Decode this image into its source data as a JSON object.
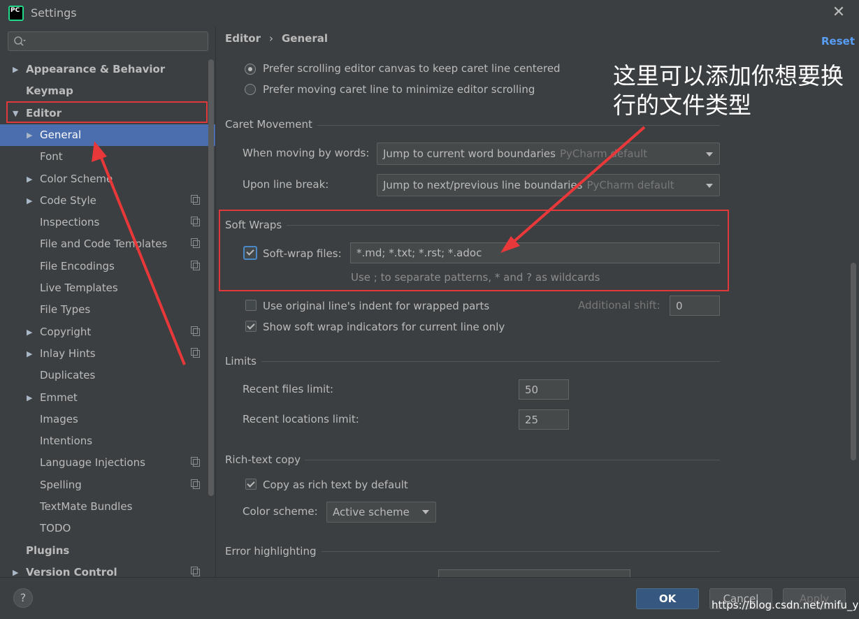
{
  "window": {
    "title": "Settings",
    "logo_text": "PC"
  },
  "search": {
    "placeholder": ""
  },
  "tree": [
    {
      "label": "Appearance & Behavior",
      "bold": true,
      "arrow": true,
      "indent": 0,
      "copy": false
    },
    {
      "label": "Keymap",
      "bold": true,
      "arrow": false,
      "indent": 0,
      "copy": false
    },
    {
      "label": "Editor",
      "bold": true,
      "arrow": true,
      "expanded": true,
      "indent": 0,
      "copy": false
    },
    {
      "label": "General",
      "bold": false,
      "arrow": true,
      "indent": 1,
      "selected": true,
      "copy": false
    },
    {
      "label": "Font",
      "bold": false,
      "arrow": false,
      "indent": 1,
      "copy": false
    },
    {
      "label": "Color Scheme",
      "bold": false,
      "arrow": true,
      "indent": 1,
      "copy": false
    },
    {
      "label": "Code Style",
      "bold": false,
      "arrow": true,
      "indent": 1,
      "copy": true
    },
    {
      "label": "Inspections",
      "bold": false,
      "arrow": false,
      "indent": 1,
      "copy": true
    },
    {
      "label": "File and Code Templates",
      "bold": false,
      "arrow": false,
      "indent": 1,
      "copy": true
    },
    {
      "label": "File Encodings",
      "bold": false,
      "arrow": false,
      "indent": 1,
      "copy": true
    },
    {
      "label": "Live Templates",
      "bold": false,
      "arrow": false,
      "indent": 1,
      "copy": false
    },
    {
      "label": "File Types",
      "bold": false,
      "arrow": false,
      "indent": 1,
      "copy": false
    },
    {
      "label": "Copyright",
      "bold": false,
      "arrow": true,
      "indent": 1,
      "copy": true
    },
    {
      "label": "Inlay Hints",
      "bold": false,
      "arrow": true,
      "indent": 1,
      "copy": true
    },
    {
      "label": "Duplicates",
      "bold": false,
      "arrow": false,
      "indent": 1,
      "copy": false
    },
    {
      "label": "Emmet",
      "bold": false,
      "arrow": true,
      "indent": 1,
      "copy": false
    },
    {
      "label": "Images",
      "bold": false,
      "arrow": false,
      "indent": 1,
      "copy": false
    },
    {
      "label": "Intentions",
      "bold": false,
      "arrow": false,
      "indent": 1,
      "copy": false
    },
    {
      "label": "Language Injections",
      "bold": false,
      "arrow": false,
      "indent": 1,
      "copy": true
    },
    {
      "label": "Spelling",
      "bold": false,
      "arrow": false,
      "indent": 1,
      "copy": true
    },
    {
      "label": "TextMate Bundles",
      "bold": false,
      "arrow": false,
      "indent": 1,
      "copy": false
    },
    {
      "label": "TODO",
      "bold": false,
      "arrow": false,
      "indent": 1,
      "copy": false
    },
    {
      "label": "Plugins",
      "bold": true,
      "arrow": false,
      "indent": 0,
      "copy": false
    },
    {
      "label": "Version Control",
      "bold": true,
      "arrow": true,
      "indent": 0,
      "copy": true
    }
  ],
  "breadcrumb": {
    "root": "Editor",
    "sep": "›",
    "current": "General"
  },
  "reset_label": "Reset",
  "scrolling": {
    "option1": "Prefer scrolling editor canvas to keep caret line centered",
    "option2": "Prefer moving caret line to minimize editor scrolling"
  },
  "caret": {
    "title": "Caret Movement",
    "words_label": "When moving by words:",
    "words_value": "Jump to current word boundaries",
    "words_hint": "PyCharm default",
    "break_label": "Upon line break:",
    "break_value": "Jump to next/previous line boundaries",
    "break_hint": "PyCharm default"
  },
  "softwraps": {
    "title": "Soft Wraps",
    "files_label": "Soft-wrap files:",
    "files_value": "*.md; *.txt; *.rst; *.adoc",
    "help": "Use ; to separate patterns, * and ? as wildcards",
    "indent_label": "Use original line's indent for wrapped parts",
    "shift_label": "Additional shift:",
    "shift_value": "0",
    "indicators_label": "Show soft wrap indicators for current line only"
  },
  "limits": {
    "title": "Limits",
    "recent_files_label": "Recent files limit:",
    "recent_files_value": "50",
    "recent_locations_label": "Recent locations limit:",
    "recent_locations_value": "25"
  },
  "richtext": {
    "title": "Rich-text copy",
    "copy_label": "Copy as rich text by default",
    "scheme_label": "Color scheme:",
    "scheme_value": "Active scheme"
  },
  "errors": {
    "title": "Error highlighting"
  },
  "annotation": "这里可以添加你想要换行的文件类型",
  "buttons": {
    "help": "?",
    "ok": "OK",
    "cancel": "Cancel",
    "apply": "Apply"
  },
  "watermark": "https://blog.csdn.net/mifu_yu",
  "colors": {
    "accent": "#4b6eaf",
    "highlight_box": "#e0393b",
    "link": "#589df6"
  }
}
